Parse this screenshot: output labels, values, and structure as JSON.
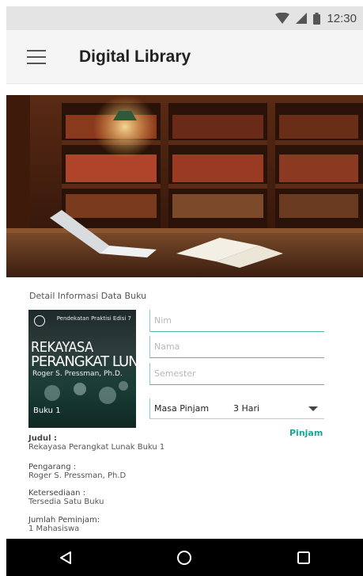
{
  "status_bar": {
    "time": "12:30"
  },
  "app_bar": {
    "title": "Digital Library"
  },
  "section": {
    "title": "Detail Informasi Data Buku"
  },
  "book_cover": {
    "subtitle": "Pendekatan Praktisi Edisi 7",
    "title_line1": "REKAYASA",
    "title_line2": "PERANGKAT LUNAK",
    "author": "Roger S. Pressman, Ph.D.",
    "volume": "Buku 1"
  },
  "form": {
    "nim_placeholder": "Nim",
    "nama_placeholder": "Nama",
    "semester_placeholder": "Semester",
    "masa_pinjam_label": "Masa Pinjam",
    "masa_pinjam_value": "3 Hari",
    "submit_label": "Pinjam"
  },
  "details": {
    "judul_label": "Judul :",
    "judul_value": "Rekayasa Perangkat Lunak Buku 1",
    "pengarang_label": "Pengarang :",
    "pengarang_value": "Roger S. Pressman, Ph.D",
    "ketersediaan_label": "Ketersediaan :",
    "ketersediaan_value": "Tersedia Satu Buku",
    "jumlah_label": "Jumlah Peminjam:",
    "jumlah_value": "1 Mahasiswa"
  },
  "colors": {
    "accent": "#1ea592",
    "field_line": "#5bb5ad",
    "nav_bg": "#000000"
  },
  "icons": [
    "wifi-icon",
    "signal-icon",
    "battery-icon",
    "menu-icon",
    "back-icon",
    "home-icon",
    "recents-icon"
  ]
}
